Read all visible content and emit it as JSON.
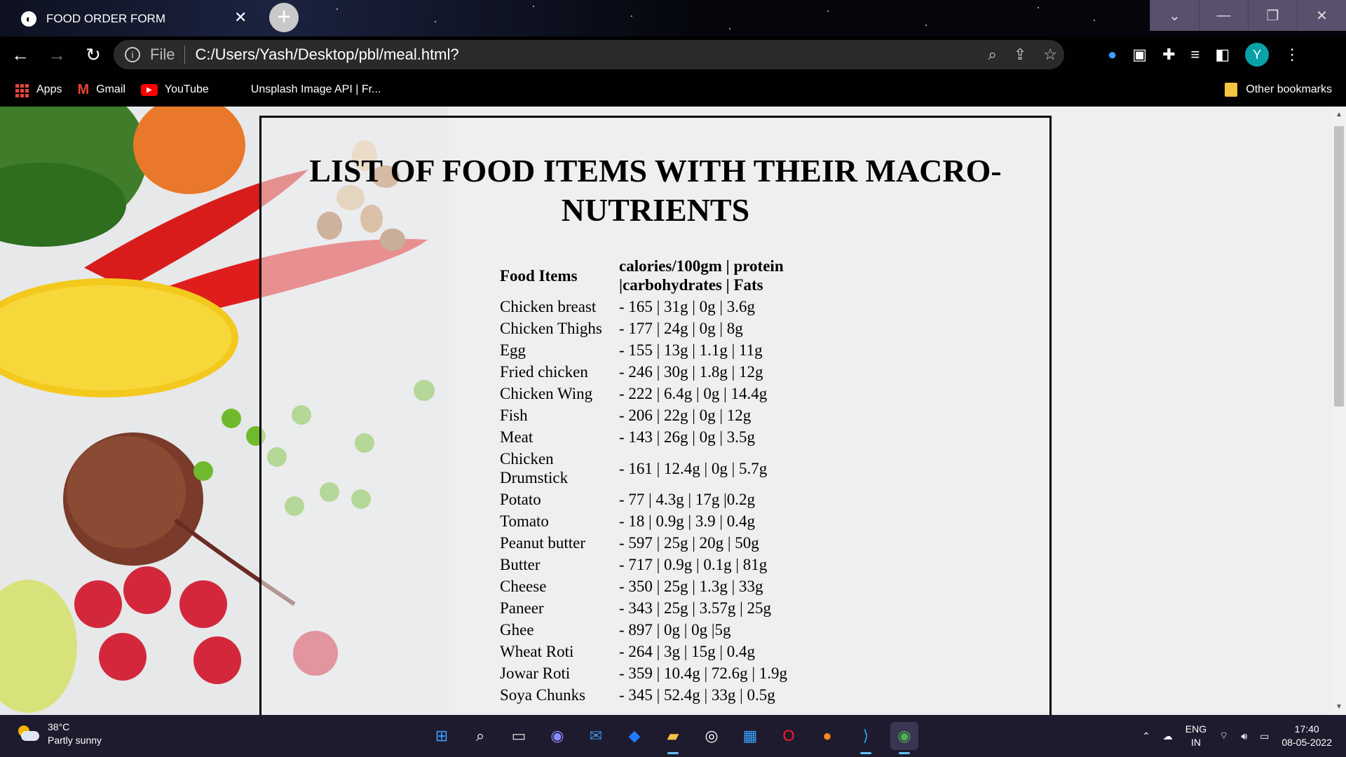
{
  "browser": {
    "tab_title": "FOOD ORDER FORM",
    "tab_close": "✕",
    "new_tab": "+",
    "window_controls": [
      "⌄",
      "—",
      "❐",
      "✕"
    ],
    "file_label": "File",
    "url": "C:/Users/Yash/Desktop/pbl/meal.html?",
    "avatar_letter": "Y",
    "bookmarks": {
      "apps": "Apps",
      "gmail": "Gmail",
      "youtube": "YouTube",
      "unsplash": "Unsplash Image API | Fr...",
      "other": "Other bookmarks"
    }
  },
  "page": {
    "title": "LIST OF FOOD ITEMS WITH THEIR MACRO-NUTRIENTS",
    "headers": {
      "food": "Food Items",
      "macros": "calories/100gm | protein |carbohydrates | Fats"
    },
    "rows": [
      {
        "food": "Chicken breast",
        "macros": "- 165 | 31g | 0g | 3.6g"
      },
      {
        "food": "Chicken Thighs",
        "macros": "- 177 | 24g | 0g | 8g"
      },
      {
        "food": "Egg",
        "macros": "- 155 | 13g | 1.1g | 11g"
      },
      {
        "food": "Fried chicken",
        "macros": "- 246 | 30g | 1.8g | 12g"
      },
      {
        "food": "Chicken Wing",
        "macros": "- 222 | 6.4g | 0g | 14.4g"
      },
      {
        "food": "Fish",
        "macros": "- 206 | 22g | 0g | 12g"
      },
      {
        "food": "Meat",
        "macros": "- 143 | 26g | 0g | 3.5g"
      },
      {
        "food": "Chicken Drumstick",
        "macros": "- 161 | 12.4g | 0g | 5.7g"
      },
      {
        "food": "Potato",
        "macros": "- 77 | 4.3g | 17g |0.2g"
      },
      {
        "food": "Tomato",
        "macros": "- 18 | 0.9g | 3.9 | 0.4g"
      },
      {
        "food": "Peanut butter",
        "macros": "- 597 | 25g | 20g | 50g"
      },
      {
        "food": "Butter",
        "macros": "- 717 | 0.9g | 0.1g | 81g"
      },
      {
        "food": "Cheese",
        "macros": "- 350 | 25g | 1.3g | 33g"
      },
      {
        "food": "Paneer",
        "macros": "- 343 | 25g | 3.57g | 25g"
      },
      {
        "food": "Ghee",
        "macros": "- 897 | 0g | 0g |5g"
      },
      {
        "food": "Wheat Roti",
        "macros": "- 264 | 3g | 15g | 0.4g"
      },
      {
        "food": "Jowar Roti",
        "macros": "- 359 | 10.4g | 72.6g | 1.9g"
      },
      {
        "food": "Soya Chunks",
        "macros": "- 345 | 52.4g | 33g | 0.5g"
      }
    ]
  },
  "taskbar": {
    "weather_temp": "38°C",
    "weather_desc": "Partly sunny",
    "lang_top": "ENG",
    "lang_bottom": "IN",
    "time": "17:40",
    "date": "08-05-2022"
  },
  "colors": {
    "avatar": "#0aa1a8",
    "page_bg": "#efeff1",
    "taskbar": "#1f1b2e"
  }
}
